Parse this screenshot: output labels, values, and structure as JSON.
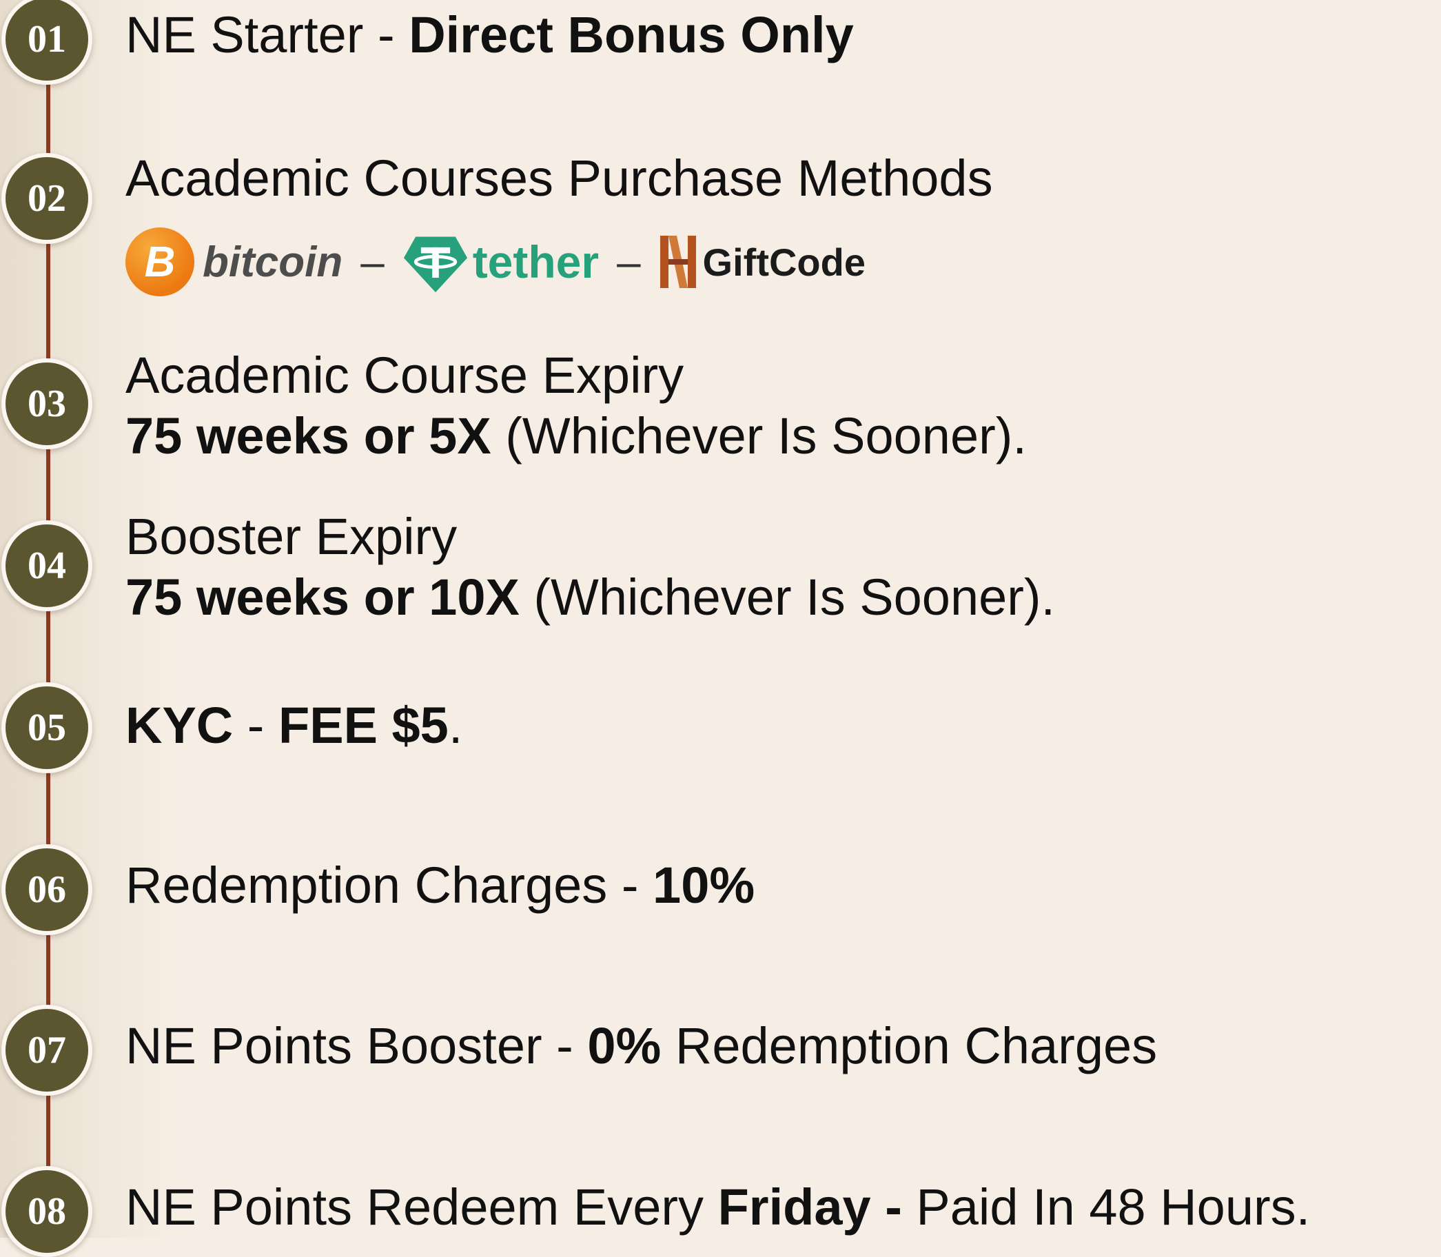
{
  "steps": [
    {
      "num": "01",
      "parts": [
        {
          "text": "NE Starter - ",
          "bold": false
        },
        {
          "text": "Direct Bonus Only",
          "bold": true
        }
      ]
    },
    {
      "num": "02",
      "title": "Academic Courses Purchase Methods",
      "methods": {
        "bitcoin": "bitcoin",
        "tether": "tether",
        "giftcode": "GiftCode",
        "separator": "–"
      }
    },
    {
      "num": "03",
      "title": "Academic Course Expiry",
      "bold": "75 weeks or 5X",
      "rest": " (Whichever Is Sooner)."
    },
    {
      "num": "04",
      "title": "Booster Expiry",
      "bold": "75 weeks or 10X",
      "rest": " (Whichever Is Sooner)."
    },
    {
      "num": "05",
      "parts": [
        {
          "text": "KYC",
          "bold": true
        },
        {
          "text": " - ",
          "bold": false
        },
        {
          "text": "FEE $5",
          "bold": true
        },
        {
          "text": ".",
          "bold": false
        }
      ]
    },
    {
      "num": "06",
      "parts": [
        {
          "text": "Redemption Charges - ",
          "bold": false
        },
        {
          "text": "10%",
          "bold": true
        }
      ]
    },
    {
      "num": "07",
      "parts": [
        {
          "text": "NE Points Booster - ",
          "bold": false
        },
        {
          "text": "0%",
          "bold": true
        },
        {
          "text": " Redemption Charges",
          "bold": false
        }
      ]
    },
    {
      "num": "08",
      "parts": [
        {
          "text": "NE Points Redeem Every ",
          "bold": false
        },
        {
          "text": "Friday -",
          "bold": true
        },
        {
          "text": " Paid In 48 Hours.",
          "bold": false
        }
      ]
    }
  ],
  "colors": {
    "background": "#f6eee4",
    "badge": "#5c5630",
    "timeline": "#8a3b22",
    "bitcoin": "#f7931a",
    "tether": "#26a17b",
    "giftcode": "#b5531f"
  },
  "icons": {
    "bitcoin": "bitcoin-coin-icon",
    "tether": "tether-diamond-icon",
    "giftcode": "giftcode-logo-icon"
  }
}
